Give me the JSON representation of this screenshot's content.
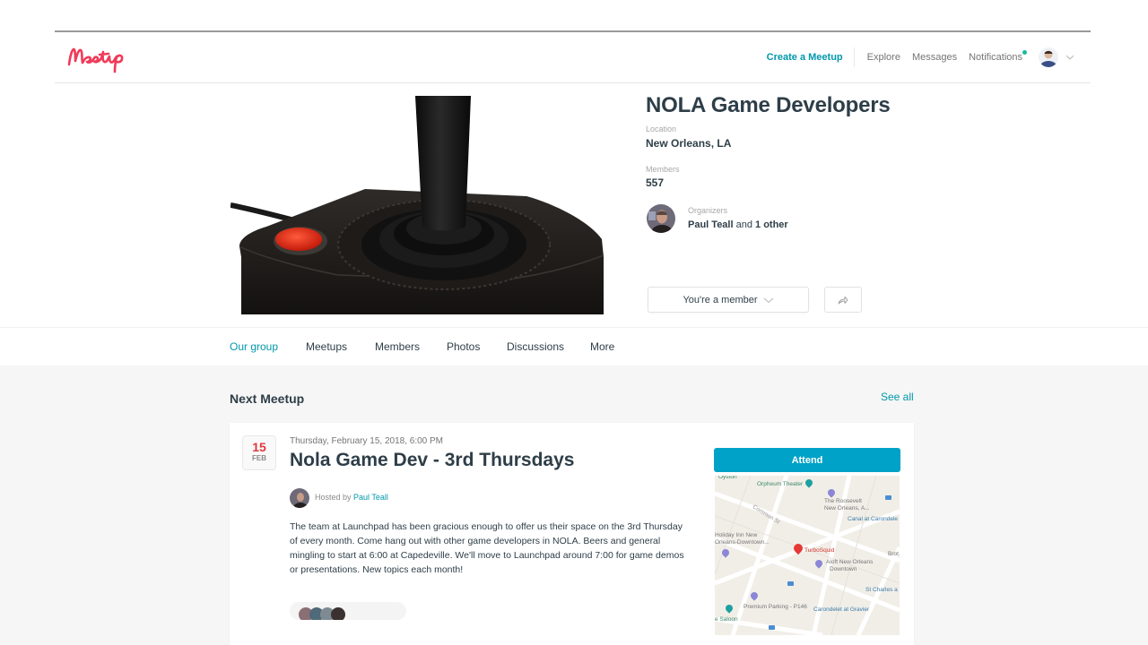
{
  "header": {
    "logo_text": "Meetup",
    "nav": {
      "create": "Create a Meetup",
      "explore": "Explore",
      "messages": "Messages",
      "notifications": "Notifications"
    }
  },
  "group": {
    "name": "NOLA Game Developers",
    "location_label": "Location",
    "location": "New Orleans, LA",
    "members_label": "Members",
    "members": "557",
    "organizers_label": "Organizers",
    "organizer_name": "Paul Teall",
    "organizer_and": " and ",
    "organizer_others": "1 other",
    "member_button": "You're a member"
  },
  "tabs": [
    {
      "label": "Our group",
      "active": true
    },
    {
      "label": "Meetups"
    },
    {
      "label": "Members"
    },
    {
      "label": "Photos"
    },
    {
      "label": "Discussions"
    },
    {
      "label": "More"
    }
  ],
  "next_meetup": {
    "section_title": "Next Meetup",
    "see_all": "See all",
    "date_day": "15",
    "date_month": "FEB",
    "datetime": "Thursday, February 15, 2018, 6:00 PM",
    "title": "Nola Game Dev - 3rd Thursdays",
    "hosted_by_label": "Hosted by ",
    "host": "Paul Teall",
    "description": "The team at Launchpad has been gracious enough to offer us their space on the 3rd Thursday of every month. Come hang out with other game developers in NOLA. Beers and general mingling to start at 6:00 at Capedeville. We'll move to Launchpad around 7:00 for game demos or presentations. New topics each month!",
    "attend_button": "Attend",
    "map": {
      "labels": {
        "orpheum": "Orpheum Theater",
        "roosevelt": "The Roosevelt New Orleans, A...",
        "canal": "Canal at Carondelet",
        "holiday": "Holiday Inn New Orleans-Downtown",
        "turbosquid": "TurboSquid",
        "aloft": "Aloft New Orleans Downtown",
        "st_charles": "St Charles a",
        "premium": "Premium Parking - P146",
        "carondelet": "Carondelet at Gravier",
        "saloon": "e Saloon",
        "brot": "Brot",
        "common": "Common St"
      }
    }
  },
  "colors": {
    "brand": "#f13a59",
    "accent": "#0098ab",
    "attend": "#00a2c7",
    "date_red": "#e0393e",
    "notif_dot": "#1abc9c"
  }
}
